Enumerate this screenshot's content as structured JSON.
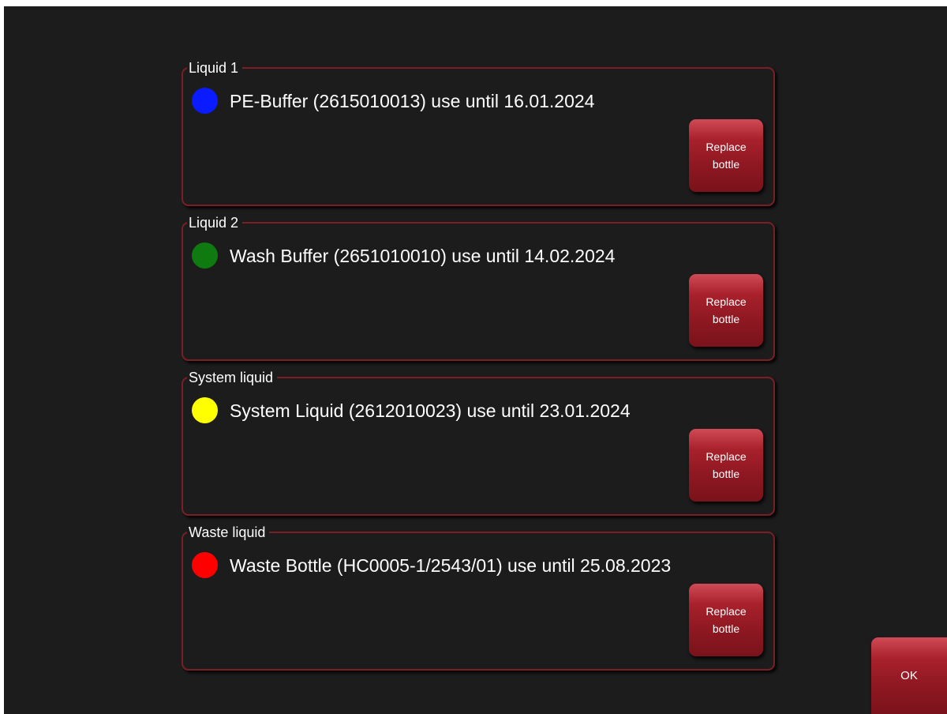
{
  "groups": [
    {
      "title": "Liquid 1",
      "color": "#0a1bff",
      "text": "PE-Buffer (2615010013) use until 16.01.2024",
      "button_label": "Replace bottle"
    },
    {
      "title": "Liquid 2",
      "color": "#0f7a10",
      "text": "Wash Buffer (2651010010) use until 14.02.2024",
      "button_label": "Replace bottle"
    },
    {
      "title": "System liquid",
      "color": "#ffff00",
      "text": "System Liquid (2612010023) use until 23.01.2024",
      "button_label": "Replace bottle"
    },
    {
      "title": "Waste liquid",
      "color": "#ff0000",
      "text": "Waste Bottle (HC0005-1/2543/01) use until 25.08.2023",
      "button_label": "Replace bottle"
    }
  ],
  "ok_label": "OK"
}
